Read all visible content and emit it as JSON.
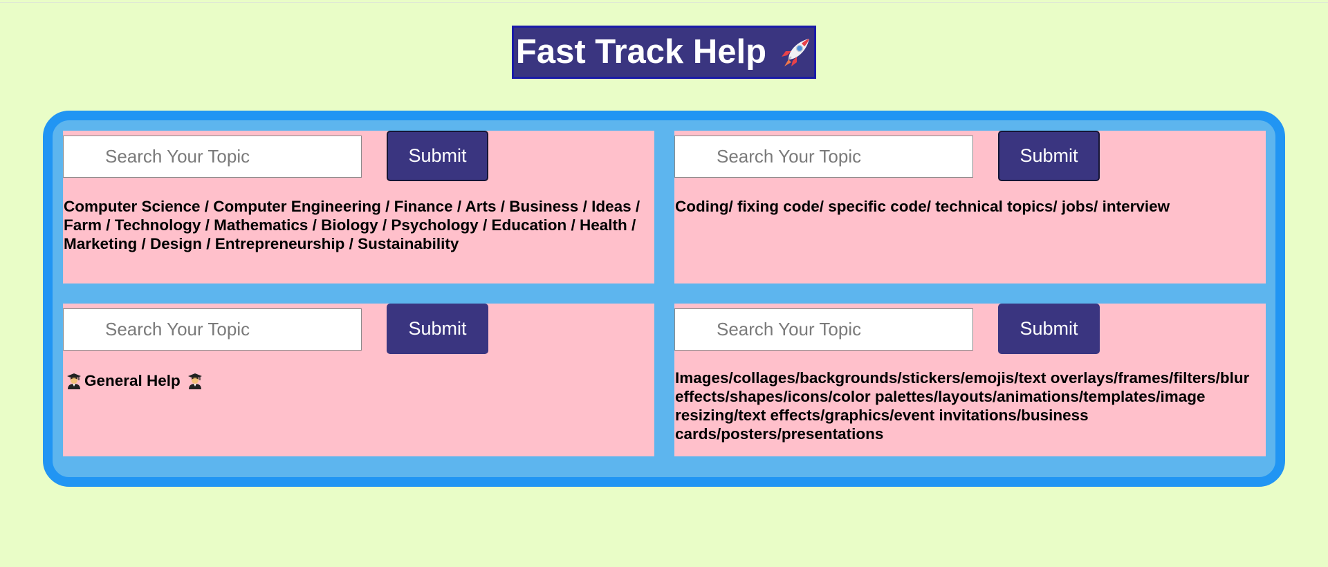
{
  "header": {
    "title": "Fast Track Help",
    "title_icon": "rocket-icon"
  },
  "cards": [
    {
      "search_placeholder": "Search Your Topic",
      "submit_label": "Submit",
      "description": "Computer Science / Computer Engineering / Finance / Arts / Business / Ideas / Farm / Technology / Mathematics / Biology / Psychology / Education / Health / Marketing / Design / Entrepreneurship / Sustainability"
    },
    {
      "search_placeholder": "Search Your Topic",
      "submit_label": "Submit",
      "description": "Coding/ fixing code/ specific code/ technical topics/ jobs/ interview"
    },
    {
      "search_placeholder": "Search Your Topic",
      "submit_label": "Submit",
      "description": "General Help",
      "icon": "graduate-icon"
    },
    {
      "search_placeholder": "Search Your Topic",
      "submit_label": "Submit",
      "description": "Images/collages/backgrounds/stickers/emojis/text overlays/frames/filters/blur effects/shapes/icons/color palettes/layouts/animations/templates/image resizing/text effects/graphics/event invitations/business cards/posters/presentations"
    }
  ],
  "colors": {
    "page_background": "#e9fdc7",
    "title_background": "#3a3580",
    "container_border": "#2195f3",
    "container_fill": "#5db5ee",
    "card_background": "#ffc0cb",
    "button_background": "#3a3580"
  }
}
